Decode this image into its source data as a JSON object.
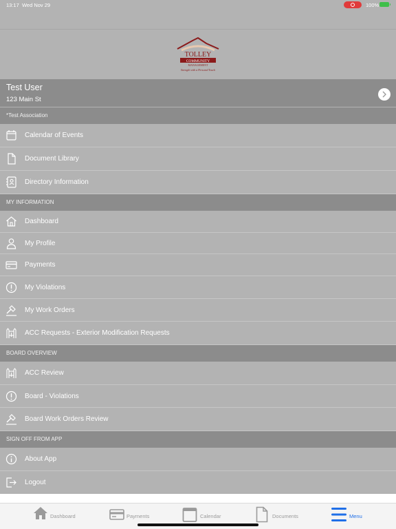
{
  "status": {
    "time": "13:17",
    "date": "Wed Nov 29",
    "battery": "100%"
  },
  "logo": {
    "line1": "TOLLEY",
    "line2": "COMMUNITY",
    "line3": "MANAGEMENT",
    "tagline": "Strength with a Personal Touch"
  },
  "user": {
    "name": "Test User",
    "address": "123 Main St"
  },
  "association": {
    "label": "*Test Association"
  },
  "association_items": [
    {
      "label": "Calendar of Events",
      "icon": "calendar-icon"
    },
    {
      "label": "Document Library",
      "icon": "document-icon"
    },
    {
      "label": "Directory Information",
      "icon": "contact-card-icon"
    }
  ],
  "sections": {
    "my_information": "MY INFORMATION",
    "board_overview": "BOARD OVERVIEW",
    "sign_off": "SIGN OFF FROM APP"
  },
  "my_information_items": [
    {
      "label": "Dashboard",
      "icon": "home-icon"
    },
    {
      "label": "My Profile",
      "icon": "person-icon"
    },
    {
      "label": "Payments",
      "icon": "credit-card-icon"
    },
    {
      "label": "My Violations",
      "icon": "alert-circle-icon"
    },
    {
      "label": "My Work Orders",
      "icon": "hammer-icon"
    },
    {
      "label": "ACC Requests - Exterior Modification Requests",
      "icon": "fence-icon"
    }
  ],
  "board_items": [
    {
      "label": "ACC Review",
      "icon": "fence-icon"
    },
    {
      "label": "Board - Violations",
      "icon": "alert-circle-icon"
    },
    {
      "label": "Board Work Orders Review",
      "icon": "hammer-icon"
    }
  ],
  "sign_off_items": [
    {
      "label": "About App",
      "icon": "info-icon"
    },
    {
      "label": "Logout",
      "icon": "logout-icon"
    }
  ],
  "tabs": [
    {
      "label": "Dashboard",
      "icon": "home-icon",
      "active": false
    },
    {
      "label": "Payments",
      "icon": "credit-card-icon",
      "active": false
    },
    {
      "label": "Calendar",
      "icon": "calendar-icon",
      "active": false
    },
    {
      "label": "Documents",
      "icon": "document-icon",
      "active": false
    },
    {
      "label": "Menu",
      "icon": "menu-icon",
      "active": true
    }
  ],
  "colors": {
    "accent": "#1f6fe8",
    "header_gray": "#8c8c8c",
    "row_gray": "#b3b3b3",
    "logo_red": "#8b1a1a"
  }
}
